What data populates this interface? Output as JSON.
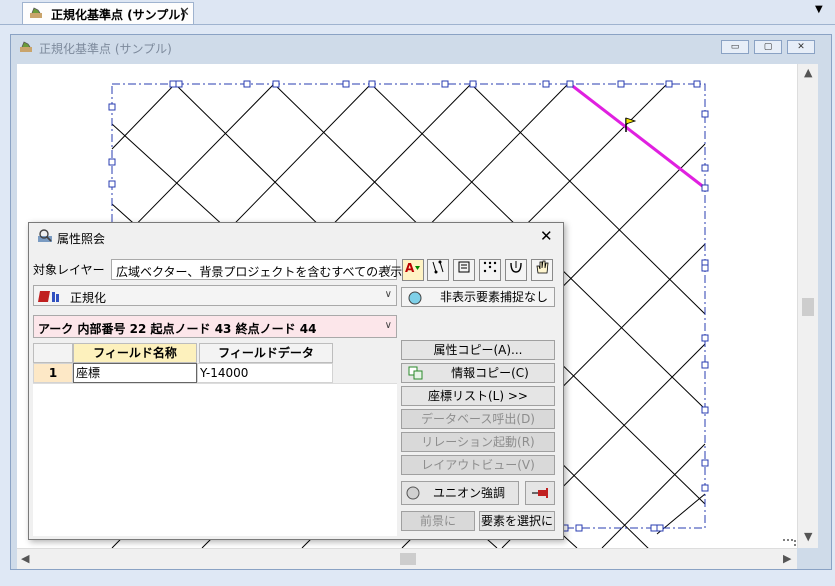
{
  "tab": {
    "label": "正規化基準点 (サンプル)",
    "close": "✕",
    "menu": "▼"
  },
  "mdi": {
    "title": "正規化基準点 (サンプル)",
    "min": "▭",
    "max": "▢",
    "close": "✕"
  },
  "dialog": {
    "title": "属性照会",
    "close": "✕",
    "layer_label": "対象レイヤー",
    "layer_value": "広域ベクター、背景プロジェクトを含むすべての表示",
    "layer_name": "正規化",
    "hidden_snap": "非表示要素捕捉なし",
    "arc_info": "アーク 内部番号 22  起点ノード 43 終点ノード 44",
    "grid": {
      "headers": [
        "フィールド名称",
        "フィールドデータ"
      ],
      "rows": [
        {
          "num": "1",
          "field": "座標",
          "data": "Y-14000"
        }
      ]
    },
    "buttons": {
      "attr_copy": "属性コピー(A)...",
      "info_copy": "情報コピー(C)",
      "coord_list": "座標リスト(L) >>",
      "db_call": "データベース呼出(D)",
      "relation": "リレーション起動(R)",
      "layout_view": "レイアウトビュー(V)",
      "union": "ユニオン強調",
      "prev": "前景に",
      "select": "要素を選択に"
    }
  },
  "colors": {
    "highlight_line": "#e020e0",
    "frame": "#2a3cb0",
    "tint": "#fce6ea"
  }
}
